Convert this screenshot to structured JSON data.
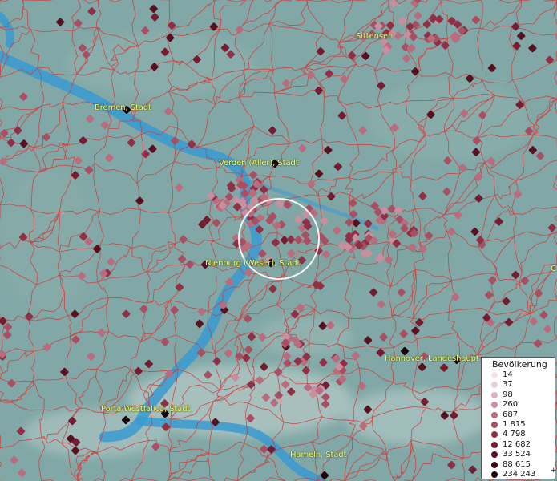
{
  "map": {
    "places": [
      {
        "id": "sittensen",
        "label": "Sittensen"
      },
      {
        "id": "bremen",
        "label": "Bremen, Stadt"
      },
      {
        "id": "verden",
        "label": "Verden (Aller), Stadt"
      },
      {
        "id": "nienburg",
        "label": "Nienburg (Weser), Stadt"
      },
      {
        "id": "hannover",
        "label": "Hannover, Landeshaupt"
      },
      {
        "id": "porta",
        "label": "Porta Westfalica, Stadt"
      },
      {
        "id": "hameln",
        "label": "Hameln, Stadt"
      },
      {
        "id": "edge_c",
        "label": "C"
      }
    ]
  },
  "legend": {
    "title": "Bevölkerung",
    "entries": [
      {
        "label": "14",
        "color": "#f6e3ea"
      },
      {
        "label": "37",
        "color": "#eccdd6"
      },
      {
        "label": "98",
        "color": "#ddb0bd"
      },
      {
        "label": "260",
        "color": "#c98f9e"
      },
      {
        "label": "687",
        "color": "#b86c7e"
      },
      {
        "label": "1 815",
        "color": "#a74f63"
      },
      {
        "label": "4 798",
        "color": "#8f3146"
      },
      {
        "label": "12 682",
        "color": "#741c30"
      },
      {
        "label": "33 524",
        "color": "#561220"
      },
      {
        "label": "88 615",
        "color": "#3a0a14"
      },
      {
        "label": "234 243",
        "color": "#1a0407"
      }
    ],
    "overflow_marker": "+"
  }
}
